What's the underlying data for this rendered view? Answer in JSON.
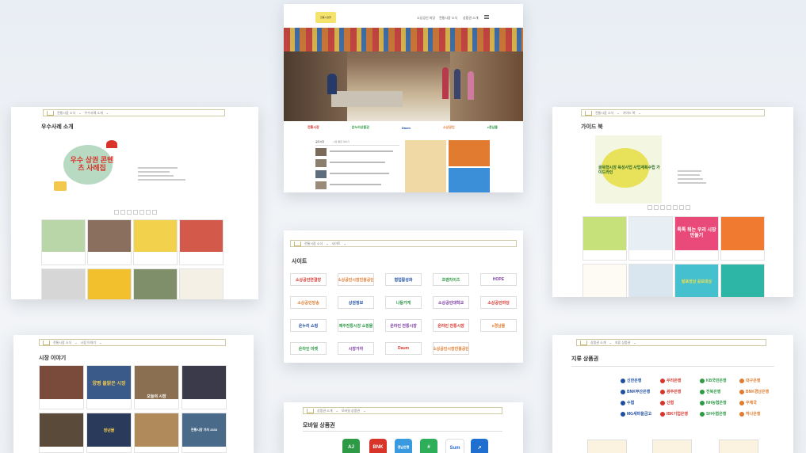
{
  "center_home": {
    "logo_text": "전통시장몰",
    "nav": [
      "소상공인 마당",
      "전통시장 소식",
      "상품권 소개"
    ],
    "menu_icon": "hamburger-icon",
    "brand_logos": [
      "전통시장",
      "온누리상품권",
      "Daum",
      "소상공인",
      "e경남몰"
    ],
    "news_tab": "공지사항",
    "news_tab2": "시장 통합 이야기"
  },
  "top_left": {
    "crumb_1": "전통시장 소식",
    "crumb_2": "우수사례 소개",
    "title": "우수사례 소개",
    "poster_text": "우수 상권 콘텐츠 사례집",
    "poster_year": "2021"
  },
  "top_right": {
    "crumb_1": "전통시장 소식",
    "crumb_2": "가이드 북",
    "title": "가이드 북",
    "poster_text": "골목형시장 육성사업 사업계획수립 가이드라인",
    "tile_text_1": "톡톡 튀는 우리 시장 만들기",
    "tile_text_2": "발표영상 공모대상"
  },
  "mid_center": {
    "crumb_1": "전통시장 소식",
    "crumb_2": "사이트",
    "title": "사이트",
    "logos": [
      [
        "소상공인연결망",
        "소상공인시장진흥공단",
        "협업활성화",
        "프랜차이즈",
        "HOPE"
      ],
      [
        "소상공인방송",
        "상권정보",
        "나들가게",
        "소상공인대학교",
        "소상공인마당"
      ],
      [
        "온누리 쇼핑",
        "제주전통시장 쇼핑몰",
        "온라인 전통시장",
        "온라인 전통시장",
        "e경남몰"
      ],
      [
        "온라인 마켓",
        "시장가자",
        "Daum",
        "소상공인시장진흥공단"
      ]
    ]
  },
  "bottom_left": {
    "crumb_1": "전통시장 소식",
    "crumb_2": "시장 이야기",
    "title": "시장 이야기",
    "tile_1": "양평 물맑은 시장",
    "tile_2": "오늘의 시장",
    "tile_3": "청년몰",
    "tile_4": "전통시장 가자 2333"
  },
  "bottom_center": {
    "crumb_1": "상품권 소개",
    "crumb_2": "모바일 상품권",
    "title": "모바일 상품권",
    "apps": [
      "AJ",
      "BNK",
      "경남은행",
      "#",
      "Sum",
      "↗"
    ]
  },
  "bottom_right": {
    "crumb_1": "상품권 소개",
    "crumb_2": "지류 상품권",
    "title": "지류 상품권",
    "banks": [
      [
        "신한은행",
        "우리은행",
        "KB국민은행",
        "대구은행"
      ],
      [
        "BNK부산은행",
        "광주은행",
        "전북은행",
        "BNK경남은행"
      ],
      [
        "수협",
        "신협",
        "NH농협은행",
        "우체국"
      ],
      [
        "MG새마을금고",
        "IBK기업은행",
        "SH수협은행",
        "하나은행"
      ]
    ]
  },
  "colors": {
    "accent": "#c9b870",
    "blue": "#1f4fa3",
    "red": "#d8342a",
    "green": "#2f9a46"
  }
}
